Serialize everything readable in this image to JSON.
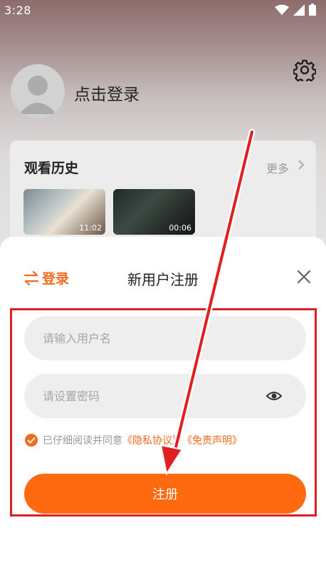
{
  "status_bar": {
    "time": "3:28"
  },
  "profile": {
    "login_prompt": "点击登录"
  },
  "history": {
    "title": "观看历史",
    "more": "更多",
    "items": [
      {
        "duration": "11:02"
      },
      {
        "duration": "00:06"
      }
    ]
  },
  "register_sheet": {
    "login_link": "登录",
    "title": "新用户注册",
    "username_placeholder": "请输入用户名",
    "password_placeholder": "请设置密码",
    "agreement_prefix": "已仔细阅读并同意",
    "privacy_link": "《隐私协议》",
    "disclaimer_link": "《免责声明》",
    "submit_label": "注册"
  },
  "colors": {
    "accent": "#ff6a10",
    "annotation": "#e02020"
  }
}
